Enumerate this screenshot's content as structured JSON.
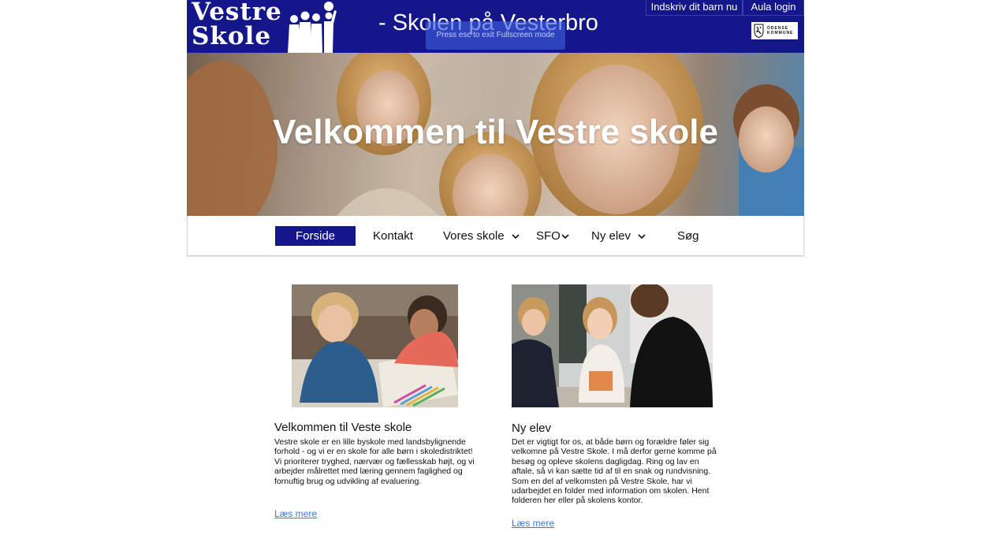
{
  "header": {
    "logo": {
      "line1": "Vestre",
      "line2": "Skole"
    },
    "tagline": "- Skolen på Vesterbro",
    "fullscreen_notice": "Press esc to exit Fullscreen mode",
    "enroll_link": "Indskriv dit barn nu",
    "aula_link": "Aula login",
    "kommune_logo": {
      "line1": "ODENSE",
      "line2": "KOMMUNE"
    }
  },
  "hero": {
    "title": "Velkommen til Vestre skole"
  },
  "nav": {
    "items": [
      {
        "label": "Forside",
        "active": true,
        "has_dropdown": false
      },
      {
        "label": "Kontakt",
        "active": false,
        "has_dropdown": false
      },
      {
        "label": "Vores skole",
        "active": false,
        "has_dropdown": true
      },
      {
        "label": "SFO",
        "active": false,
        "has_dropdown": true
      },
      {
        "label": "Ny elev",
        "active": false,
        "has_dropdown": true
      },
      {
        "label": "Søg",
        "active": false,
        "has_dropdown": false
      }
    ]
  },
  "cards": [
    {
      "title": "Velkommen til Veste skole",
      "body_lines": [
        "Vestre skole er en lille byskole med landsbylignende",
        "forhold - og vi  er en skole for alle børn i skoledistriktet!",
        "Vi prioriterer  tryghed, nærvær og fællesskab højt,  og vi",
        "arbejder målrettet med læring gennem faglighed og",
        "fornuftig brug og udvikling af evaluering."
      ],
      "link": "Læs mere"
    },
    {
      "title": "Ny elev",
      "body_lines": [
        "Det er vigtigt for os, at både børn og forældre føler sig",
        "velkomne på Vestre Skole. I må derfor gerne komme på",
        "besøg og opleve skolens dagligdag. Ring og lav en",
        "aftale, så vi kan sætte tid af til en snak og rundvisning.",
        "Som en del af velkomsten på Vestre Skole, har vi",
        "udarbejdet en folder med information om skolen. Hent",
        "folderen her eller på skolens kontor."
      ],
      "link": "Læs mere"
    }
  ],
  "colors": {
    "brand_blue": "#14178a",
    "link_blue": "#3a7bd5"
  }
}
